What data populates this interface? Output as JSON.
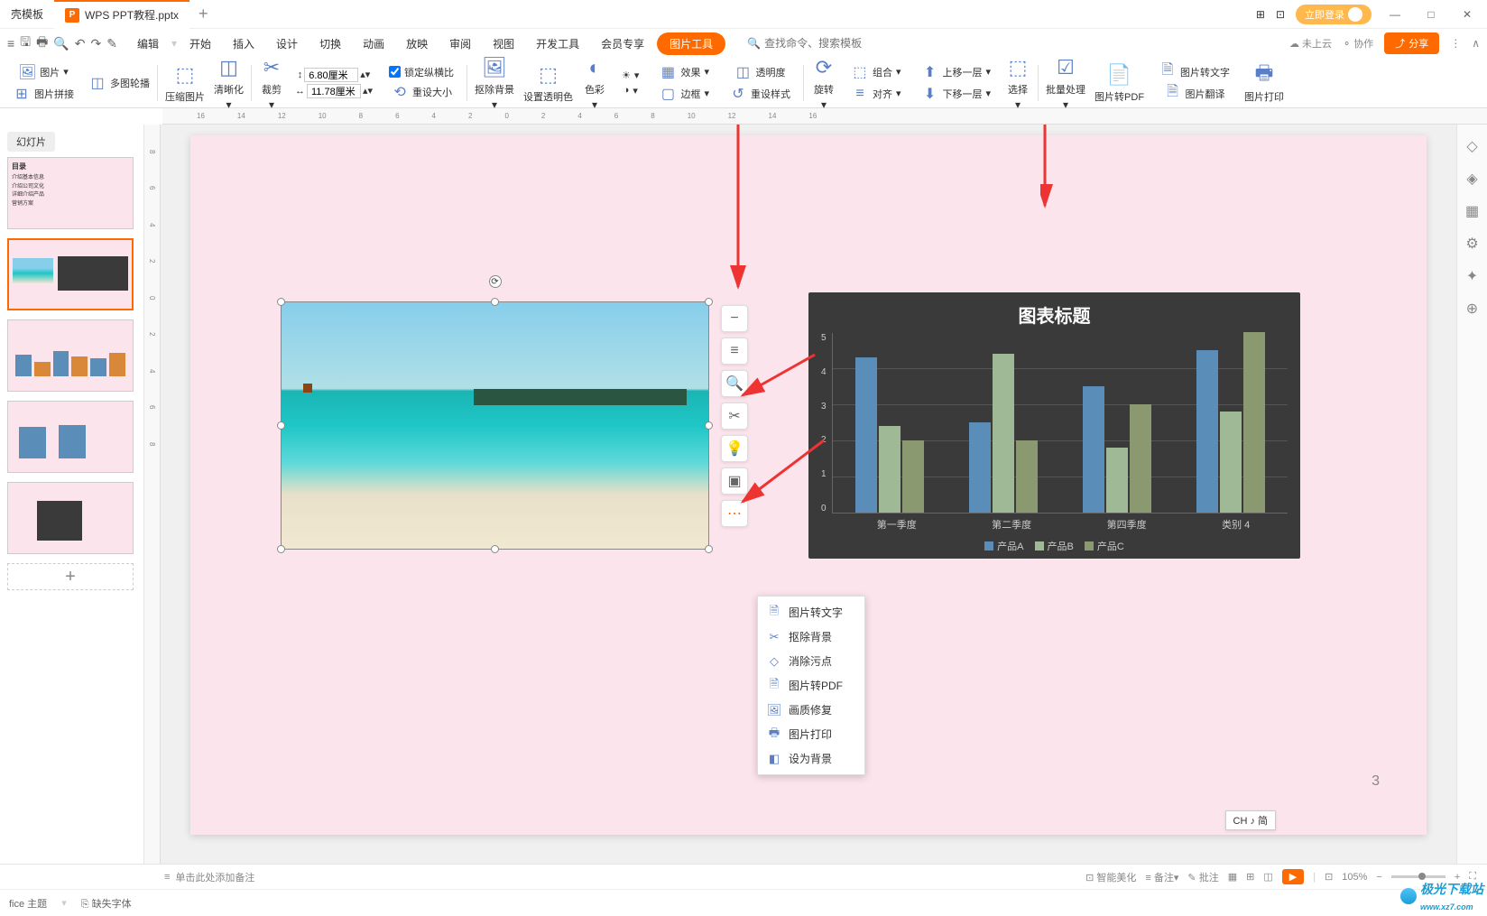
{
  "tabs": {
    "template": "壳模板",
    "active": "WPS PPT教程.pptx"
  },
  "titlebar": {
    "login": "立即登录"
  },
  "menu": {
    "edit": "编辑",
    "start": "开始",
    "insert": "插入",
    "design": "设计",
    "transition": "切换",
    "animation": "动画",
    "slideshow": "放映",
    "review": "审阅",
    "view": "视图",
    "devtools": "开发工具",
    "member": "会员专享",
    "pictools": "图片工具",
    "search_ph": "查找命令、搜索模板",
    "not_cloud": "未上云",
    "collab": "协作",
    "share": "分享"
  },
  "ribbon": {
    "pic": "图片",
    "multi_outline": "多图轮播",
    "pic_join": "图片拼接",
    "compress": "压缩图片",
    "clarity": "清晰化",
    "crop": "裁剪",
    "width_label": "6.80厘米",
    "height_label": "11.78厘米",
    "lock_ratio": "锁定纵横比",
    "reset_size": "重设大小",
    "remove_bg": "抠除背景",
    "set_trans": "设置透明色",
    "color": "色彩",
    "effect": "效果",
    "transparency": "透明度",
    "border": "边框",
    "reset_style": "重设样式",
    "rotate": "旋转",
    "combine": "组合",
    "align": "对齐",
    "move_up": "上移一层",
    "move_down": "下移一层",
    "select": "选择",
    "batch": "批量处理",
    "to_pdf": "图片转PDF",
    "to_text": "图片转文字",
    "translate": "图片翻译",
    "print": "图片打印"
  },
  "sidebar": {
    "tab": "幻灯片",
    "toc_title": "目录",
    "toc_items": [
      "介绍基本信息",
      "介绍公司文化",
      "详细介绍产品",
      "营销方案"
    ]
  },
  "float_menu": {
    "to_text": "图片转文字",
    "remove_bg": "抠除背景",
    "clean_spot": "消除污点",
    "to_pdf": "图片转PDF",
    "quality": "画质修复",
    "print": "图片打印",
    "set_bg": "设为背景"
  },
  "chart_data": {
    "type": "bar",
    "title": "图表标题",
    "categories": [
      "第一季度",
      "第二季度",
      "第四季度",
      "类别 4"
    ],
    "series": [
      {
        "name": "产品A",
        "values": [
          4.3,
          2.5,
          3.5,
          4.5
        ],
        "color": "#5a8db8"
      },
      {
        "name": "产品B",
        "values": [
          2.4,
          4.4,
          1.8,
          2.8
        ],
        "color": "#9fb896"
      },
      {
        "name": "产品C",
        "values": [
          2.0,
          2.0,
          3.0,
          5.0
        ],
        "color": "#8a9970"
      }
    ],
    "ylim": [
      0,
      5
    ],
    "yticks": [
      0,
      1,
      2,
      3,
      4,
      5
    ]
  },
  "status": {
    "notes_ph": "单击此处添加备注",
    "beautify": "智能美化",
    "notes": "备注",
    "approve": "批注",
    "zoom": "105%",
    "theme": "fice 主题",
    "missing_font": "缺失字体",
    "page_num": "3",
    "ime": "CH ♪ 简"
  },
  "watermark": {
    "name": "极光下载站",
    "url": "www.xz7.com"
  }
}
